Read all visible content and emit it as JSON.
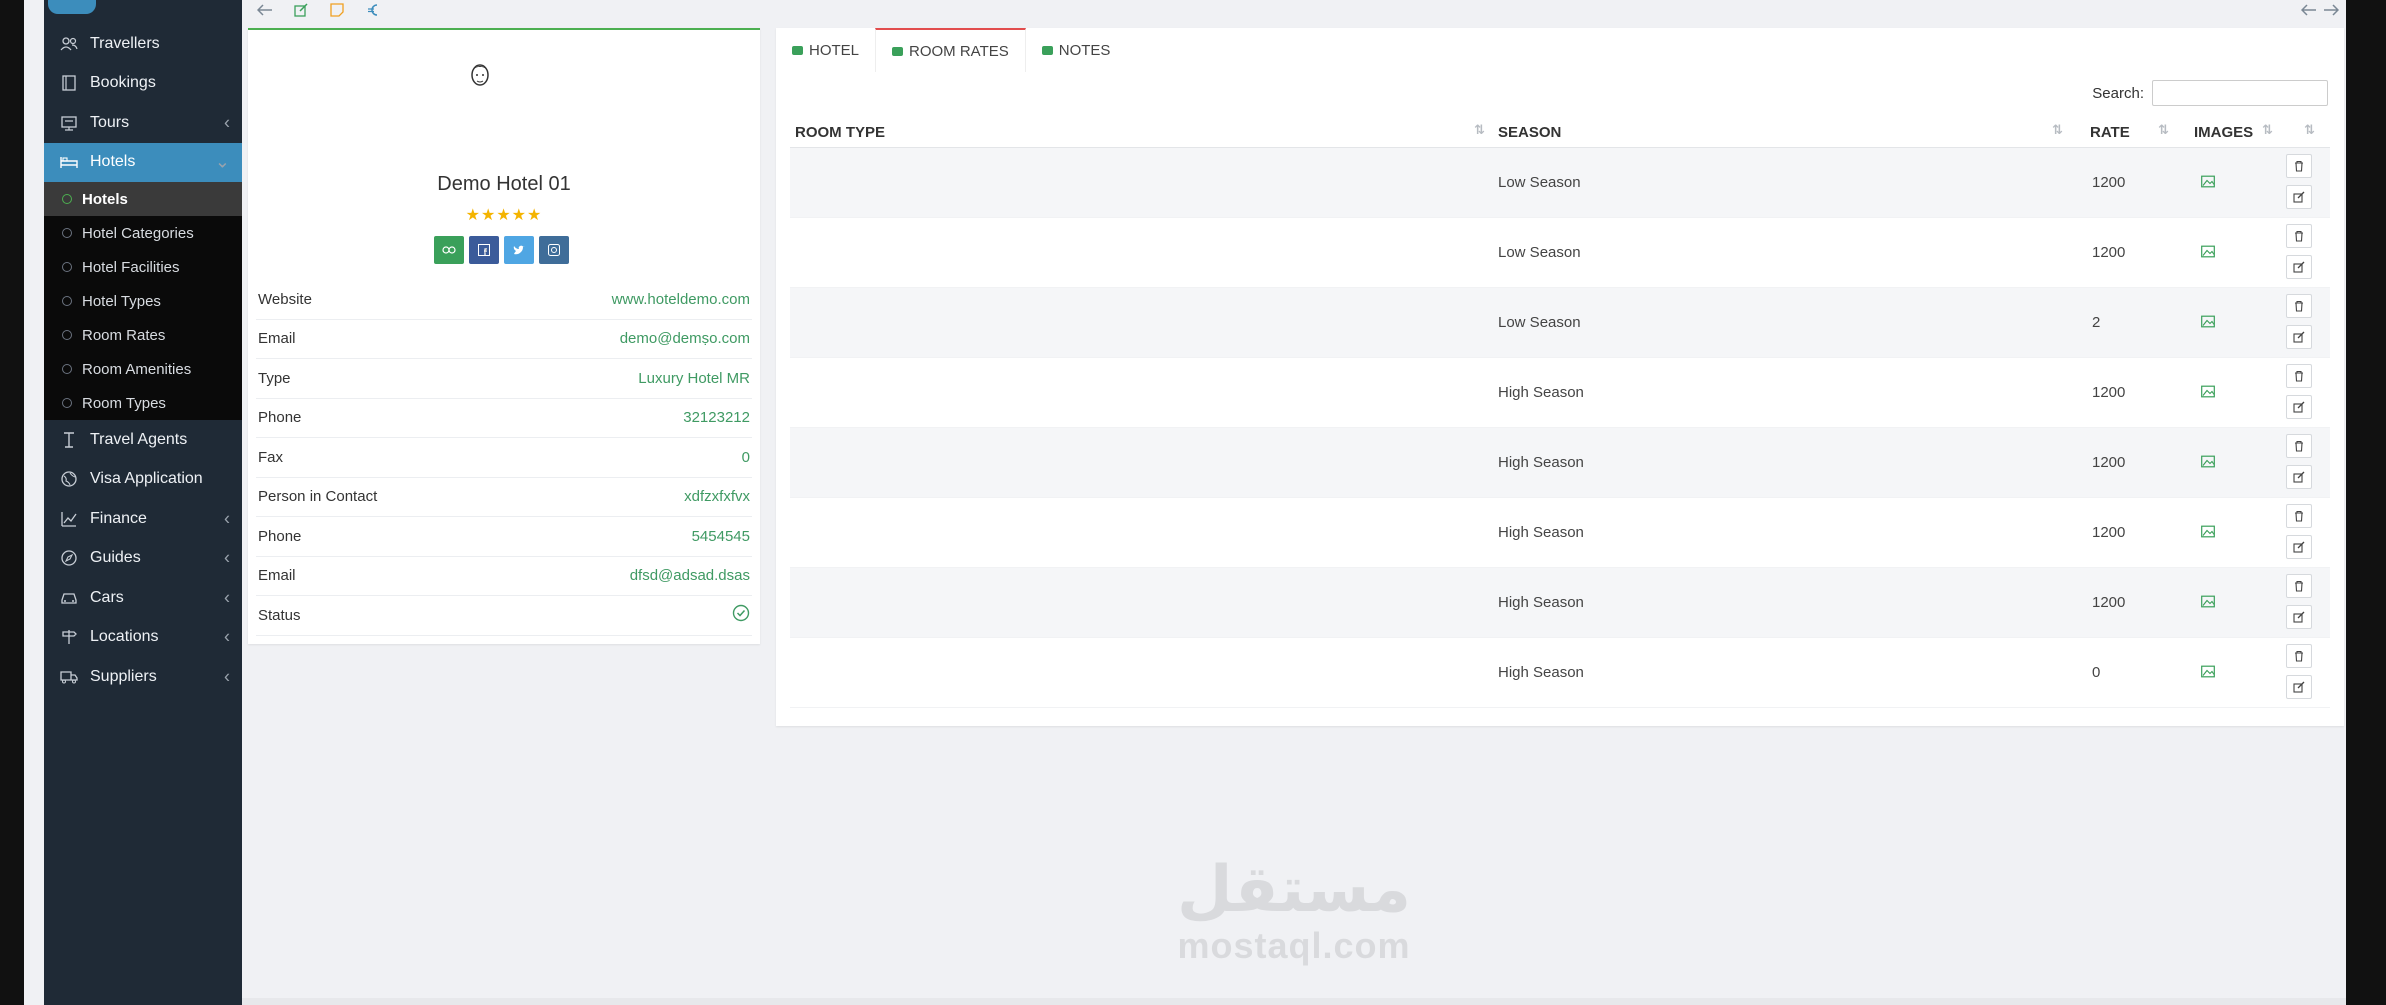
{
  "sidebar": {
    "items": [
      {
        "label": "Travellers",
        "icon": "users-icon",
        "has_arrow": false
      },
      {
        "label": "Bookings",
        "icon": "book-icon",
        "has_arrow": false
      },
      {
        "label": "Tours",
        "icon": "map-board-icon",
        "has_arrow": true
      },
      {
        "label": "Hotels",
        "icon": "bed-icon",
        "has_arrow": true,
        "active": true
      }
    ],
    "submenu": [
      {
        "label": "Hotels",
        "active": true
      },
      {
        "label": "Hotel Categories"
      },
      {
        "label": "Hotel Facilities"
      },
      {
        "label": "Hotel Types"
      },
      {
        "label": "Room Rates"
      },
      {
        "label": "Room Amenities"
      },
      {
        "label": "Room Types"
      }
    ],
    "items_after": [
      {
        "label": "Travel Agents",
        "icon": "agent-icon",
        "has_arrow": false
      },
      {
        "label": "Visa Application",
        "icon": "globe-icon",
        "has_arrow": false
      },
      {
        "label": "Finance",
        "icon": "chart-icon",
        "has_arrow": true
      },
      {
        "label": "Guides",
        "icon": "compass-icon",
        "has_arrow": true
      },
      {
        "label": "Cars",
        "icon": "car-icon",
        "has_arrow": true
      },
      {
        "label": "Locations",
        "icon": "signpost-icon",
        "has_arrow": true
      },
      {
        "label": "Suppliers",
        "icon": "truck-icon",
        "has_arrow": true
      }
    ]
  },
  "hotel": {
    "name": "Demo Hotel 01",
    "stars": "★★★★★",
    "details": [
      {
        "key": "Website",
        "value": "www.hoteldemo.com"
      },
      {
        "key": "Email",
        "value": "demo@demṣo.com"
      },
      {
        "key": "Type",
        "value": "Luxury Hotel MR"
      },
      {
        "key": "Phone",
        "value": "32123212"
      },
      {
        "key": "Fax",
        "value": "0"
      },
      {
        "key": "Person in Contact",
        "value": "xdfzxfxfvx"
      },
      {
        "key": "Phone",
        "value": "5454545"
      },
      {
        "key": "Email",
        "value": "dfsd@adsad.dsas"
      },
      {
        "key": "Status",
        "value": ""
      }
    ]
  },
  "tabs": [
    {
      "label": "HOTEL",
      "active": false
    },
    {
      "label": "ROOM RATES",
      "active": true
    },
    {
      "label": "NOTES",
      "active": false
    }
  ],
  "search": {
    "label": "Search:",
    "value": ""
  },
  "rates_table": {
    "headers": {
      "room_type": "ROOM TYPE",
      "season": "SEASON",
      "rate": "RATE",
      "images": "IMAGES"
    },
    "rows": [
      {
        "room_type": "",
        "season": "Low Season",
        "rate": "1200"
      },
      {
        "room_type": "",
        "season": "Low Season",
        "rate": "1200"
      },
      {
        "room_type": "",
        "season": "Low Season",
        "rate": "2"
      },
      {
        "room_type": "",
        "season": "High Season",
        "rate": "1200"
      },
      {
        "room_type": "",
        "season": "High Season",
        "rate": "1200"
      },
      {
        "room_type": "",
        "season": "High Season",
        "rate": "1200"
      },
      {
        "room_type": "",
        "season": "High Season",
        "rate": "1200"
      },
      {
        "room_type": "",
        "season": "High Season",
        "rate": "0"
      }
    ]
  },
  "watermark": {
    "arabic": "مستقل",
    "latin": "mostaql.com"
  },
  "colors": {
    "accent": "#3c8dbc",
    "green": "#3f9a63",
    "star": "#f4b400",
    "tab_active": "#e24d4d"
  }
}
